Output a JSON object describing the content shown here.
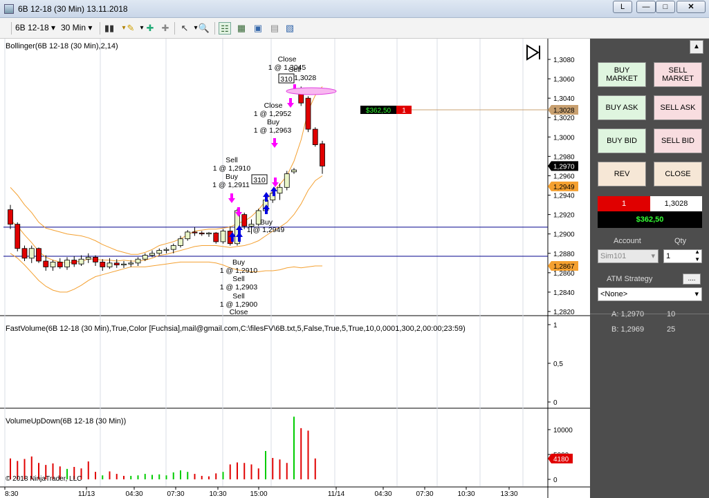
{
  "window": {
    "title": "6B 12-18 (30 Min)  13.11.2018",
    "link_button": "L"
  },
  "toolbar": {
    "instrument": "6B 12-18",
    "interval": "30 Min"
  },
  "price_panel": {
    "title": "Bollinger(6B 12-18 (30 Min),2,14)",
    "price_axis": [
      "1,3080",
      "1,3060",
      "1,3040",
      "1,3020",
      "1,3000",
      "1,2980",
      "1,2960",
      "1,2940",
      "1,2920",
      "1,2900",
      "1,2880",
      "1,2860",
      "1,2840",
      "1,2820"
    ],
    "last_price": "1,2970",
    "flag_mid": "1,3028",
    "flag_low1": "1,2949",
    "flag_low2": "1,2867",
    "position_pnl": "$362,50",
    "position_qty": "1",
    "order_box": "310",
    "order_box2": "310",
    "annotations": {
      "close_top": "Close",
      "close_top_val": "1 @ 1,3045",
      "sell_top": "Sell",
      "sell_top_val": "1 @ 1,3028",
      "close_mid": "Close",
      "close_mid_val": "1 @ 1,2952",
      "buy_mid": "Buy",
      "buy_mid_val": "1 @ 1,2963",
      "sell_left": "Sell",
      "sell_left_val": "1 @ 1,2910",
      "buy_left": "Buy",
      "buy_left_val": "1 @ 1,2911",
      "buy_right": "Buy",
      "buy_right_val": "1 @ 1,2949",
      "buy_bottom": "Buy",
      "buy_bottom_val": "1 @ 1,2910",
      "sell_bottom1": "Sell",
      "sell_bottom1_val": "1 @ 1,2903",
      "sell_bottom2": "Sell",
      "sell_bottom2_val": "1 @ 1,2900",
      "close_bottom": "Close"
    }
  },
  "fastvolume_panel": {
    "title": "FastVolume(6B 12-18 (30 Min),True,Color [Fuchsia],mail@gmail.com,C:\\filesFV\\6B.txt,5,False,True,5,True,10,0,0001,300,2,00:00;23:59)",
    "axis": [
      "1",
      "0,5",
      "0"
    ]
  },
  "volume_panel": {
    "title": "VolumeUpDown(6B 12-18 (30 Min))",
    "axis": [
      "10000",
      "5000",
      "0"
    ],
    "last_volume": "4180",
    "copyright": "© 2018 NinjaTrader, LLC"
  },
  "time_axis": [
    "8:30",
    "11/13",
    "04:30",
    "07:30",
    "10:30",
    "15:00",
    "11/14",
    "04:30",
    "07:30",
    "10:30",
    "13:30"
  ],
  "chart_data": {
    "type": "candlestick",
    "title": "6B 12-18 (30 Min)",
    "ylim": [
      1.2815,
      1.3095
    ],
    "candles": [
      {
        "o": 1.2925,
        "h": 1.293,
        "l": 1.2905,
        "c": 1.291
      },
      {
        "o": 1.291,
        "h": 1.2912,
        "l": 1.2882,
        "c": 1.2885
      },
      {
        "o": 1.2885,
        "h": 1.2888,
        "l": 1.2872,
        "c": 1.2875
      },
      {
        "o": 1.2875,
        "h": 1.2888,
        "l": 1.287,
        "c": 1.2885
      },
      {
        "o": 1.2885,
        "h": 1.2886,
        "l": 1.287,
        "c": 1.2872
      },
      {
        "o": 1.2872,
        "h": 1.2878,
        "l": 1.2862,
        "c": 1.2866
      },
      {
        "o": 1.2866,
        "h": 1.2873,
        "l": 1.2862,
        "c": 1.2871
      },
      {
        "o": 1.2871,
        "h": 1.2875,
        "l": 1.2864,
        "c": 1.2866
      },
      {
        "o": 1.2866,
        "h": 1.2876,
        "l": 1.2863,
        "c": 1.2873
      },
      {
        "o": 1.2873,
        "h": 1.2877,
        "l": 1.2866,
        "c": 1.2869
      },
      {
        "o": 1.2869,
        "h": 1.2878,
        "l": 1.2867,
        "c": 1.2874
      },
      {
        "o": 1.2874,
        "h": 1.288,
        "l": 1.287,
        "c": 1.2876
      },
      {
        "o": 1.2876,
        "h": 1.2878,
        "l": 1.2867,
        "c": 1.2871
      },
      {
        "o": 1.2871,
        "h": 1.2874,
        "l": 1.2862,
        "c": 1.2866
      },
      {
        "o": 1.2866,
        "h": 1.2875,
        "l": 1.2864,
        "c": 1.287
      },
      {
        "o": 1.287,
        "h": 1.2874,
        "l": 1.2865,
        "c": 1.2868
      },
      {
        "o": 1.2868,
        "h": 1.2872,
        "l": 1.2865,
        "c": 1.2869
      },
      {
        "o": 1.2869,
        "h": 1.2873,
        "l": 1.2866,
        "c": 1.287
      },
      {
        "o": 1.287,
        "h": 1.2876,
        "l": 1.2867,
        "c": 1.2874
      },
      {
        "o": 1.2874,
        "h": 1.288,
        "l": 1.2872,
        "c": 1.2878
      },
      {
        "o": 1.2878,
        "h": 1.2883,
        "l": 1.2876,
        "c": 1.288
      },
      {
        "o": 1.288,
        "h": 1.2885,
        "l": 1.2878,
        "c": 1.2883
      },
      {
        "o": 1.2883,
        "h": 1.2886,
        "l": 1.288,
        "c": 1.2884
      },
      {
        "o": 1.2884,
        "h": 1.289,
        "l": 1.288,
        "c": 1.2888
      },
      {
        "o": 1.2888,
        "h": 1.2898,
        "l": 1.2886,
        "c": 1.2895
      },
      {
        "o": 1.2895,
        "h": 1.2904,
        "l": 1.2893,
        "c": 1.2902
      },
      {
        "o": 1.2902,
        "h": 1.2907,
        "l": 1.2898,
        "c": 1.2901
      },
      {
        "o": 1.2901,
        "h": 1.2903,
        "l": 1.2898,
        "c": 1.29
      },
      {
        "o": 1.29,
        "h": 1.2902,
        "l": 1.2897,
        "c": 1.2901
      },
      {
        "o": 1.2901,
        "h": 1.2902,
        "l": 1.289,
        "c": 1.2892
      },
      {
        "o": 1.2892,
        "h": 1.2905,
        "l": 1.289,
        "c": 1.2903
      },
      {
        "o": 1.2903,
        "h": 1.2908,
        "l": 1.2888,
        "c": 1.289
      },
      {
        "o": 1.289,
        "h": 1.2926,
        "l": 1.2888,
        "c": 1.2924
      },
      {
        "o": 1.292,
        "h": 1.2922,
        "l": 1.2905,
        "c": 1.2908
      },
      {
        "o": 1.2908,
        "h": 1.2915,
        "l": 1.29,
        "c": 1.291
      },
      {
        "o": 1.291,
        "h": 1.2926,
        "l": 1.2908,
        "c": 1.2924
      },
      {
        "o": 1.2924,
        "h": 1.2937,
        "l": 1.2922,
        "c": 1.2935
      },
      {
        "o": 1.2935,
        "h": 1.2945,
        "l": 1.2932,
        "c": 1.2942
      },
      {
        "o": 1.2942,
        "h": 1.2952,
        "l": 1.2935,
        "c": 1.2948
      },
      {
        "o": 1.2948,
        "h": 1.2965,
        "l": 1.2945,
        "c": 1.2962
      },
      {
        "o": 1.2964,
        "h": 1.2968,
        "l": 1.2962,
        "c": 1.2966
      },
      {
        "o": 1.3045,
        "h": 1.3052,
        "l": 1.3032,
        "c": 1.3035
      },
      {
        "o": 1.304,
        "h": 1.3042,
        "l": 1.3005,
        "c": 1.3008
      },
      {
        "o": 1.3008,
        "h": 1.301,
        "l": 1.299,
        "c": 1.2992
      },
      {
        "o": 1.2993,
        "h": 1.2996,
        "l": 1.2962,
        "c": 1.297
      }
    ],
    "bollinger_upper": [
      1.2948,
      1.294,
      1.293,
      1.2922,
      1.2912,
      1.2906,
      1.2904,
      1.2902,
      1.29,
      1.2899,
      1.2898,
      1.2896,
      1.2893,
      1.2889,
      1.2886,
      1.2883,
      1.2881,
      1.2879,
      1.2879,
      1.2881,
      1.2884,
      1.2888,
      1.289,
      1.2892,
      1.2895,
      1.2899,
      1.2903,
      1.2904,
      1.2905,
      1.2905,
      1.2906,
      1.2907,
      1.2911,
      1.2913,
      1.2918,
      1.2925,
      1.2934,
      1.2944,
      1.2951,
      1.296,
      1.2975,
      1.2997,
      1.3027,
      1.3043,
      1.3052
    ],
    "bollinger_lower": [
      1.288,
      1.2875,
      1.2868,
      1.286,
      1.2852,
      1.2846,
      1.2842,
      1.284,
      1.284,
      1.2843,
      1.2847,
      1.2852,
      1.2856,
      1.2858,
      1.286,
      1.2862,
      1.2864,
      1.2866,
      1.2866,
      1.2866,
      1.2867,
      1.2868,
      1.2869,
      1.287,
      1.2871,
      1.2871,
      1.2871,
      1.2871,
      1.2871,
      1.287,
      1.2868,
      1.2865,
      1.2863,
      1.2862,
      1.2861,
      1.2861,
      1.2862,
      1.2862,
      1.2863,
      1.2865,
      1.2866,
      1.2865,
      1.2866,
      1.2867,
      1.2867
    ],
    "bollinger_mid": [
      1.2914,
      1.2908,
      1.2899,
      1.2891,
      1.2882,
      1.2876,
      1.2873,
      1.2871,
      1.287,
      1.2871,
      1.2872,
      1.2874,
      1.2874,
      1.2873,
      1.2873,
      1.2872,
      1.2873,
      1.2872,
      1.2872,
      1.2873,
      1.2875,
      1.2878,
      1.2879,
      1.2881,
      1.2883,
      1.2885,
      1.2887,
      1.2888,
      1.2888,
      1.2888,
      1.2887,
      1.2886,
      1.2887,
      1.2888,
      1.289,
      1.2893,
      1.2898,
      1.2903,
      1.2907,
      1.2912,
      1.292,
      1.2931,
      1.2945,
      1.2955,
      1.296
    ],
    "horizontal_lines": [
      1.2907,
      1.2877
    ],
    "position_line": 1.3028,
    "volume": [
      {
        "up": 0,
        "down": 4200
      },
      {
        "up": 0,
        "down": 3700
      },
      {
        "up": 0,
        "down": 4100
      },
      {
        "up": 0,
        "down": 4600
      },
      {
        "up": 0,
        "down": 3300
      },
      {
        "up": 0,
        "down": 2900
      },
      {
        "up": 0,
        "down": 3200
      },
      {
        "up": 0,
        "down": 2600
      },
      {
        "up": 2100,
        "down": 0
      },
      {
        "up": 0,
        "down": 2500
      },
      {
        "up": 0,
        "down": 2200
      },
      {
        "up": 0,
        "down": 3600
      },
      {
        "up": 0,
        "down": 1500
      },
      {
        "up": 800,
        "down": 0
      },
      {
        "up": 0,
        "down": 1600
      },
      {
        "up": 0,
        "down": 1100
      },
      {
        "up": 0,
        "down": 700
      },
      {
        "up": 700,
        "down": 0
      },
      {
        "up": 800,
        "down": 0
      },
      {
        "up": 1100,
        "down": 0
      },
      {
        "up": 900,
        "down": 0
      },
      {
        "up": 1000,
        "down": 0
      },
      {
        "up": 800,
        "down": 0
      },
      {
        "up": 1400,
        "down": 0
      },
      {
        "up": 1800,
        "down": 0
      },
      {
        "up": 1500,
        "down": 0
      },
      {
        "up": 0,
        "down": 1100
      },
      {
        "up": 0,
        "down": 700
      },
      {
        "up": 0,
        "down": 600
      },
      {
        "up": 0,
        "down": 1200
      },
      {
        "up": 1500,
        "down": 0
      },
      {
        "up": 0,
        "down": 3000
      },
      {
        "up": 0,
        "down": 3400
      },
      {
        "up": 0,
        "down": 3300
      },
      {
        "up": 0,
        "down": 3000
      },
      {
        "up": 0,
        "down": 2200
      },
      {
        "up": 5700,
        "down": 0
      },
      {
        "up": 0,
        "down": 4300
      },
      {
        "up": 0,
        "down": 4000
      },
      {
        "up": 0,
        "down": 3300
      },
      {
        "up": 12600,
        "down": 0
      },
      {
        "up": 0,
        "down": 10300
      },
      {
        "up": 0,
        "down": 9800
      },
      {
        "up": 0,
        "down": 4200
      },
      {
        "up": 0,
        "down": 0
      }
    ],
    "volume_ylim": [
      0,
      13000
    ]
  },
  "trade_panel": {
    "buy_market": "BUY\nMARKET",
    "sell_market": "SELL\nMARKET",
    "buy_ask": "BUY ASK",
    "sell_ask": "SELL ASK",
    "buy_bid": "BUY BID",
    "sell_bid": "SELL BID",
    "rev": "REV",
    "close": "CLOSE",
    "position_qty": "1",
    "position_price": "1,3028",
    "position_pnl": "$362,50",
    "account_label": "Account",
    "qty_label": "Qty",
    "account_value": "Sim101",
    "qty_value": "1",
    "atm_label": "ATM Strategy",
    "atm_button": "....",
    "atm_value": "<None>",
    "ask_label": "A: 1,2970",
    "ask_size": "10",
    "bid_label": "B: 1,2969",
    "bid_size": "25"
  },
  "colors": {
    "up_candle": "#e9f5c8",
    "down_candle": "#e00000",
    "bollinger": "#f4a030",
    "hline": "#00008b",
    "position_line": "#c8a070",
    "volume_up": "#00cc00",
    "volume_down": "#e00000",
    "buy_arrow": "#0000e0",
    "sell_arrow": "#ff00ff",
    "panel_bg": "#4d4d4d"
  }
}
